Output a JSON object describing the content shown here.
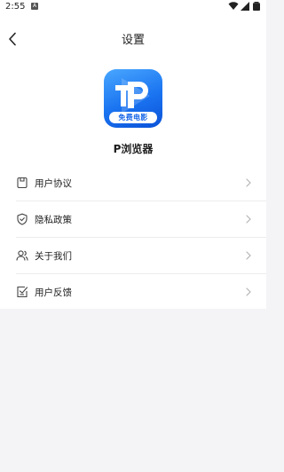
{
  "status_bar": {
    "time": "2:55",
    "notification_icon": "a-icon"
  },
  "header": {
    "title": "设置",
    "back_icon": "chevron-left-icon"
  },
  "app": {
    "logo_badge": "免费电影",
    "name": "P浏览器",
    "logo_colors": [
      "#49a7ff",
      "#1a73f0",
      "#0b52d8"
    ]
  },
  "menu": {
    "items": [
      {
        "label": "用户协议",
        "icon": "document-icon"
      },
      {
        "label": "隐私政策",
        "icon": "shield-icon"
      },
      {
        "label": "关于我们",
        "icon": "users-icon"
      },
      {
        "label": "用户反馈",
        "icon": "feedback-icon"
      }
    ]
  }
}
